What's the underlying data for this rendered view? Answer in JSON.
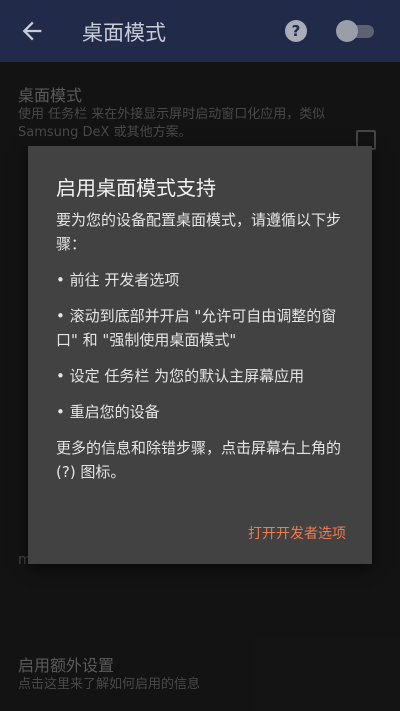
{
  "appbar": {
    "title": "桌面模式",
    "help_glyph": "?",
    "toggle_on": false
  },
  "background": {
    "pref1_title": "桌面模式",
    "pref1_summary": "使用 任务栏 来在外接显示屏时启动窗口化应用，类似 Samsung DeX 或其他方案。",
    "pref_bottom_title": "启用额外设置",
    "pref_bottom_summary": "点击这里来了解如何启用的信息",
    "mode_starts_text": "mode starts."
  },
  "dialog": {
    "title": "启用桌面模式支持",
    "intro": "要为您的设备配置桌面模式，请遵循以下步骤：",
    "steps": [
      "• 前往 开发者选项",
      "• 滚动到底部并开启 \"允许可自由调整的窗口\" 和 \"强制使用桌面模式\"",
      "• 设定 任务栏 为您的默认主屏幕应用",
      "• 重启您的设备"
    ],
    "footer": "更多的信息和除错步骤，点击屏幕右上角的 (?) 图标。",
    "action": "打开开发者选项"
  }
}
